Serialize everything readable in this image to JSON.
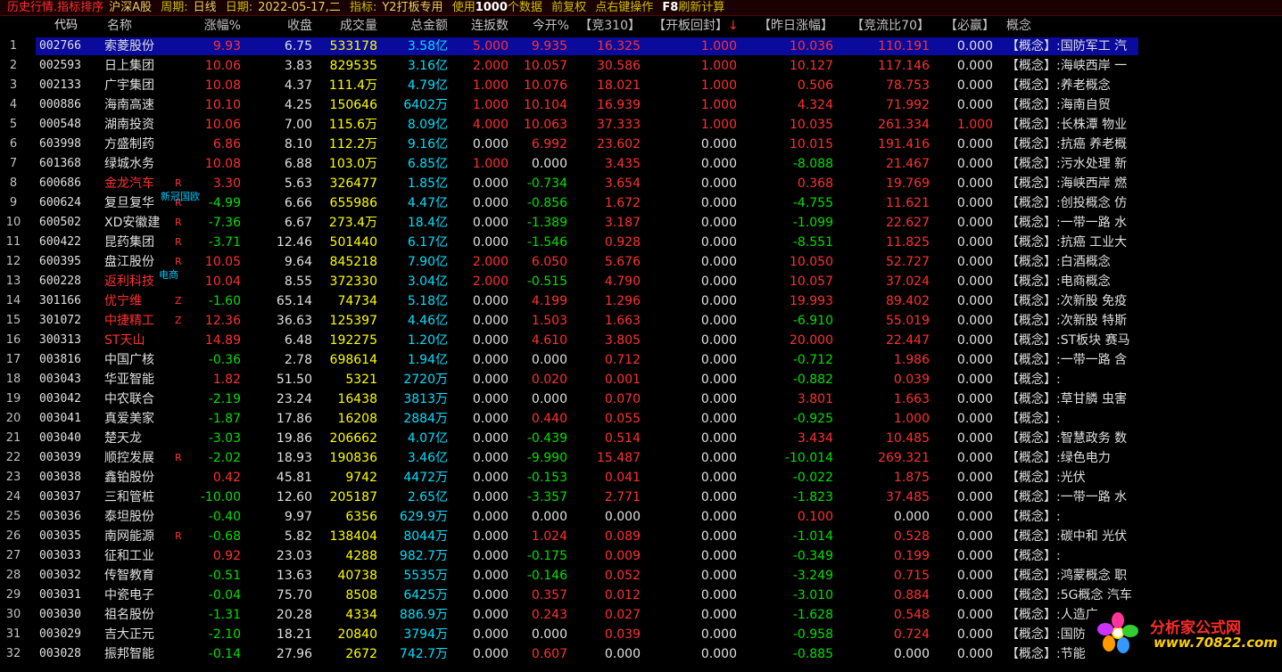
{
  "topbar": {
    "mode": "历史行情.指标排序",
    "market": "沪深A股",
    "period_label": "周期:",
    "period": "日线",
    "date_label": "日期:",
    "date": "2022-05-17,二",
    "indicator_label": "指标:",
    "indicator": "Y2打板专用",
    "use_label": "使用",
    "count": "1000",
    "count_suffix": "个数据",
    "adjust": "前复权",
    "hint": "点右键操作",
    "f8": "F8",
    "f8_text": "刷新计算"
  },
  "columns": {
    "code": "代码",
    "name": "名称",
    "pct": "涨幅%",
    "close": "收盘",
    "volume": "成交量",
    "amount": "总金额",
    "lianban": "连扳数",
    "open": "今开%",
    "jing310": "【竞310】",
    "kbhf": "【开板回封】",
    "sort_arrow": "↓",
    "zrzf": "【昨日涨幅】",
    "jlb": "【竞流比70】",
    "biying": "【必赢】",
    "gainian": "概念"
  },
  "colors": {
    "up": "#ff3030",
    "down": "#00e000",
    "flat": "#e0e0e0",
    "selection": "#0a0a9c"
  },
  "rows": [
    {
      "idx": "1",
      "code": "002766",
      "name": "索菱股份",
      "tag": "",
      "sub": "",
      "pct": "9.93",
      "close": "6.75",
      "volume": "533178",
      "amount": "3.58",
      "amount_unit": "亿",
      "lb": "5.000",
      "open": "9.935",
      "j310": "16.325",
      "kbhf": "1.000",
      "zrzf": "10.036",
      "jlb": "110.191",
      "bw": "0.000",
      "gn": "【概念】:国防军工 汽"
    },
    {
      "idx": "2",
      "code": "002593",
      "name": "日上集团",
      "tag": "",
      "sub": "",
      "pct": "10.06",
      "close": "3.83",
      "volume": "829535",
      "amount": "3.16",
      "amount_unit": "亿",
      "lb": "2.000",
      "open": "10.057",
      "j310": "30.586",
      "kbhf": "1.000",
      "zrzf": "10.127",
      "jlb": "117.146",
      "bw": "0.000",
      "gn": "【概念】:海峡西岸 一"
    },
    {
      "idx": "3",
      "code": "002133",
      "name": "广宇集团",
      "tag": "",
      "sub": "",
      "pct": "10.08",
      "close": "4.37",
      "volume": "111.4万",
      "amount": "4.79",
      "amount_unit": "亿",
      "lb": "1.000",
      "open": "10.076",
      "j310": "18.021",
      "kbhf": "1.000",
      "zrzf": "0.506",
      "jlb": "78.753",
      "bw": "0.000",
      "gn": "【概念】:养老概念"
    },
    {
      "idx": "4",
      "code": "000886",
      "name": "海南高速",
      "tag": "",
      "sub": "",
      "pct": "10.10",
      "close": "4.25",
      "volume": "150646",
      "amount": "6402",
      "amount_unit": "万",
      "lb": "1.000",
      "open": "10.104",
      "j310": "16.939",
      "kbhf": "1.000",
      "zrzf": "4.324",
      "jlb": "71.992",
      "bw": "0.000",
      "gn": "【概念】:海南自贸"
    },
    {
      "idx": "5",
      "code": "000548",
      "name": "湖南投资",
      "tag": "",
      "sub": "",
      "pct": "10.06",
      "close": "7.00",
      "volume": "115.6万",
      "amount": "8.09",
      "amount_unit": "亿",
      "lb": "4.000",
      "open": "10.063",
      "j310": "37.333",
      "kbhf": "1.000",
      "zrzf": "10.035",
      "jlb": "261.334",
      "bw": "1.000",
      "gn": "【概念】:长株潭 物业"
    },
    {
      "idx": "6",
      "code": "603998",
      "name": "方盛制药",
      "tag": "",
      "sub": "",
      "pct": "6.86",
      "close": "8.10",
      "volume": "112.2万",
      "amount": "9.16",
      "amount_unit": "亿",
      "lb": "0.000",
      "open": "6.992",
      "j310": "23.602",
      "kbhf": "0.000",
      "zrzf": "10.015",
      "jlb": "191.416",
      "bw": "0.000",
      "gn": "【概念】:抗癌 养老概"
    },
    {
      "idx": "7",
      "code": "601368",
      "name": "绿城水务",
      "tag": "",
      "sub": "",
      "pct": "10.08",
      "close": "6.88",
      "volume": "103.0万",
      "amount": "6.85",
      "amount_unit": "亿",
      "lb": "1.000",
      "open": "0.000",
      "j310": "3.435",
      "kbhf": "0.000",
      "zrzf": "-8.088",
      "jlb": "21.467",
      "bw": "0.000",
      "gn": "【概念】:污水处理 新"
    },
    {
      "idx": "8",
      "code": "600686",
      "name": "金龙汽车",
      "tag": "R",
      "sub": "",
      "pct": "3.30",
      "close": "5.63",
      "volume": "326477",
      "amount": "1.85",
      "amount_unit": "亿",
      "lb": "0.000",
      "open": "-0.734",
      "j310": "3.654",
      "kbhf": "0.000",
      "zrzf": "0.368",
      "jlb": "19.769",
      "bw": "0.000",
      "gn": "【概念】:海峡西岸 燃"
    },
    {
      "idx": "9",
      "code": "600624",
      "name": "复旦复华",
      "tag": "R",
      "sub": "新冠国欧",
      "pct": "-4.99",
      "close": "6.66",
      "volume": "655986",
      "amount": "4.47",
      "amount_unit": "亿",
      "lb": "0.000",
      "open": "-0.856",
      "j310": "1.672",
      "kbhf": "0.000",
      "zrzf": "-4.755",
      "jlb": "11.621",
      "bw": "0.000",
      "gn": "【概念】:创投概念 仿"
    },
    {
      "idx": "10",
      "code": "600502",
      "name": "XD安徽建",
      "tag": "R",
      "sub": "",
      "pct": "-7.36",
      "close": "6.67",
      "volume": "273.4万",
      "amount": "18.4",
      "amount_unit": "亿",
      "lb": "0.000",
      "open": "-1.389",
      "j310": "3.187",
      "kbhf": "0.000",
      "zrzf": "-1.099",
      "jlb": "22.627",
      "bw": "0.000",
      "gn": "【概念】:一带一路 水"
    },
    {
      "idx": "11",
      "code": "600422",
      "name": "昆药集团",
      "tag": "R",
      "sub": "",
      "pct": "-3.71",
      "close": "12.46",
      "volume": "501440",
      "amount": "6.17",
      "amount_unit": "亿",
      "lb": "0.000",
      "open": "-1.546",
      "j310": "0.928",
      "kbhf": "0.000",
      "zrzf": "-8.551",
      "jlb": "11.825",
      "bw": "0.000",
      "gn": "【概念】:抗癌 工业大"
    },
    {
      "idx": "12",
      "code": "600395",
      "name": "盘江股份",
      "tag": "R",
      "sub": "",
      "pct": "10.05",
      "close": "9.64",
      "volume": "845218",
      "amount": "7.90",
      "amount_unit": "亿",
      "lb": "2.000",
      "open": "6.050",
      "j310": "5.676",
      "kbhf": "0.000",
      "zrzf": "10.050",
      "jlb": "52.727",
      "bw": "0.000",
      "gn": "【概念】:白酒概念"
    },
    {
      "idx": "13",
      "code": "600228",
      "name": "返利科技",
      "tag": "",
      "sub": "电商",
      "pct": "10.04",
      "close": "8.55",
      "volume": "372330",
      "amount": "3.04",
      "amount_unit": "亿",
      "lb": "2.000",
      "open": "-0.515",
      "j310": "4.790",
      "kbhf": "0.000",
      "zrzf": "10.057",
      "jlb": "37.024",
      "bw": "0.000",
      "gn": "【概念】:电商概念"
    },
    {
      "idx": "14",
      "code": "301166",
      "name": "优宁维",
      "tag": "Z",
      "sub": "",
      "pct": "-1.60",
      "close": "65.14",
      "volume": "74734",
      "amount": "5.18",
      "amount_unit": "亿",
      "lb": "0.000",
      "open": "4.199",
      "j310": "1.296",
      "kbhf": "0.000",
      "zrzf": "19.993",
      "jlb": "89.402",
      "bw": "0.000",
      "gn": "【概念】:次新股 免疫"
    },
    {
      "idx": "15",
      "code": "301072",
      "name": "中捷精工",
      "tag": "Z",
      "sub": "",
      "pct": "12.36",
      "close": "36.63",
      "volume": "125397",
      "amount": "4.46",
      "amount_unit": "亿",
      "lb": "0.000",
      "open": "1.503",
      "j310": "1.663",
      "kbhf": "0.000",
      "zrzf": "-6.910",
      "jlb": "55.019",
      "bw": "0.000",
      "gn": "【概念】:次新股 特斯"
    },
    {
      "idx": "16",
      "code": "300313",
      "name": "ST天山",
      "tag": "",
      "sub": "",
      "pct": "14.89",
      "close": "6.48",
      "volume": "192275",
      "amount": "1.20",
      "amount_unit": "亿",
      "lb": "0.000",
      "open": "4.610",
      "j310": "3.805",
      "kbhf": "0.000",
      "zrzf": "20.000",
      "jlb": "22.447",
      "bw": "0.000",
      "gn": "【概念】:ST板块 赛马"
    },
    {
      "idx": "17",
      "code": "003816",
      "name": "中国广核",
      "tag": "",
      "sub": "",
      "pct": "-0.36",
      "close": "2.78",
      "volume": "698614",
      "amount": "1.94",
      "amount_unit": "亿",
      "lb": "0.000",
      "open": "0.000",
      "j310": "0.712",
      "kbhf": "0.000",
      "zrzf": "-0.712",
      "jlb": "1.986",
      "bw": "0.000",
      "gn": "【概念】:一带一路 含"
    },
    {
      "idx": "18",
      "code": "003043",
      "name": "华亚智能",
      "tag": "",
      "sub": "",
      "pct": "1.82",
      "close": "51.50",
      "volume": "5321",
      "amount": "2720",
      "amount_unit": "万",
      "lb": "0.000",
      "open": "0.020",
      "j310": "0.001",
      "kbhf": "0.000",
      "zrzf": "-0.882",
      "jlb": "0.039",
      "bw": "0.000",
      "gn": "【概念】:"
    },
    {
      "idx": "19",
      "code": "003042",
      "name": "中农联合",
      "tag": "",
      "sub": "",
      "pct": "-2.19",
      "close": "23.24",
      "volume": "16438",
      "amount": "3813",
      "amount_unit": "万",
      "lb": "0.000",
      "open": "0.000",
      "j310": "0.070",
      "kbhf": "0.000",
      "zrzf": "3.801",
      "jlb": "1.663",
      "bw": "0.000",
      "gn": "【概念】:草甘膦 虫害"
    },
    {
      "idx": "20",
      "code": "003041",
      "name": "真爱美家",
      "tag": "",
      "sub": "",
      "pct": "-1.87",
      "close": "17.86",
      "volume": "16208",
      "amount": "2884",
      "amount_unit": "万",
      "lb": "0.000",
      "open": "0.440",
      "j310": "0.055",
      "kbhf": "0.000",
      "zrzf": "-0.925",
      "jlb": "1.000",
      "bw": "0.000",
      "gn": "【概念】:"
    },
    {
      "idx": "21",
      "code": "003040",
      "name": "楚天龙",
      "tag": "",
      "sub": "",
      "pct": "-3.03",
      "close": "19.86",
      "volume": "206662",
      "amount": "4.07",
      "amount_unit": "亿",
      "lb": "0.000",
      "open": "-0.439",
      "j310": "0.514",
      "kbhf": "0.000",
      "zrzf": "3.434",
      "jlb": "10.485",
      "bw": "0.000",
      "gn": "【概念】:智慧政务 数"
    },
    {
      "idx": "22",
      "code": "003039",
      "name": "顺控发展",
      "tag": "R",
      "sub": "",
      "pct": "-2.02",
      "close": "18.93",
      "volume": "190836",
      "amount": "3.46",
      "amount_unit": "亿",
      "lb": "0.000",
      "open": "-9.990",
      "j310": "15.487",
      "kbhf": "0.000",
      "zrzf": "-10.014",
      "jlb": "269.321",
      "bw": "0.000",
      "gn": "【概念】:绿色电力"
    },
    {
      "idx": "23",
      "code": "003038",
      "name": "鑫铂股份",
      "tag": "",
      "sub": "",
      "pct": "0.42",
      "close": "45.81",
      "volume": "9742",
      "amount": "4472",
      "amount_unit": "万",
      "lb": "0.000",
      "open": "-0.153",
      "j310": "0.041",
      "kbhf": "0.000",
      "zrzf": "-0.022",
      "jlb": "1.875",
      "bw": "0.000",
      "gn": "【概念】:光伏"
    },
    {
      "idx": "24",
      "code": "003037",
      "name": "三和管桩",
      "tag": "",
      "sub": "",
      "pct": "-10.00",
      "close": "12.60",
      "volume": "205187",
      "amount": "2.65",
      "amount_unit": "亿",
      "lb": "0.000",
      "open": "-3.357",
      "j310": "2.771",
      "kbhf": "0.000",
      "zrzf": "-1.823",
      "jlb": "37.485",
      "bw": "0.000",
      "gn": "【概念】:一带一路 水"
    },
    {
      "idx": "25",
      "code": "003036",
      "name": "泰坦股份",
      "tag": "",
      "sub": "",
      "pct": "-0.40",
      "close": "9.97",
      "volume": "6356",
      "amount": "629.9",
      "amount_unit": "万",
      "lb": "0.000",
      "open": "0.000",
      "j310": "0.000",
      "kbhf": "0.000",
      "zrzf": "0.100",
      "jlb": "0.000",
      "bw": "0.000",
      "gn": "【概念】:"
    },
    {
      "idx": "26",
      "code": "003035",
      "name": "南网能源",
      "tag": "R",
      "sub": "",
      "pct": "-0.68",
      "close": "5.82",
      "volume": "138404",
      "amount": "8044",
      "amount_unit": "万",
      "lb": "0.000",
      "open": "1.024",
      "j310": "0.089",
      "kbhf": "0.000",
      "zrzf": "-1.014",
      "jlb": "0.528",
      "bw": "0.000",
      "gn": "【概念】:碳中和 光伏"
    },
    {
      "idx": "27",
      "code": "003033",
      "name": "征和工业",
      "tag": "",
      "sub": "",
      "pct": "0.92",
      "close": "23.03",
      "volume": "4288",
      "amount": "982.7",
      "amount_unit": "万",
      "lb": "0.000",
      "open": "-0.175",
      "j310": "0.009",
      "kbhf": "0.000",
      "zrzf": "-0.349",
      "jlb": "0.199",
      "bw": "0.000",
      "gn": "【概念】:"
    },
    {
      "idx": "28",
      "code": "003032",
      "name": "传智教育",
      "tag": "",
      "sub": "",
      "pct": "-0.51",
      "close": "13.63",
      "volume": "40738",
      "amount": "5535",
      "amount_unit": "万",
      "lb": "0.000",
      "open": "-0.146",
      "j310": "0.052",
      "kbhf": "0.000",
      "zrzf": "-3.249",
      "jlb": "0.715",
      "bw": "0.000",
      "gn": "【概念】:鸿蒙概念 职"
    },
    {
      "idx": "29",
      "code": "003031",
      "name": "中瓷电子",
      "tag": "",
      "sub": "",
      "pct": "-0.04",
      "close": "75.70",
      "volume": "8508",
      "amount": "6425",
      "amount_unit": "万",
      "lb": "0.000",
      "open": "0.357",
      "j310": "0.012",
      "kbhf": "0.000",
      "zrzf": "-3.010",
      "jlb": "0.884",
      "bw": "0.000",
      "gn": "【概念】:5G概念 汽车"
    },
    {
      "idx": "30",
      "code": "003030",
      "name": "祖名股份",
      "tag": "",
      "sub": "",
      "pct": "-1.31",
      "close": "20.28",
      "volume": "4334",
      "amount": "886.9",
      "amount_unit": "万",
      "lb": "0.000",
      "open": "0.243",
      "j310": "0.027",
      "kbhf": "0.000",
      "zrzf": "-1.628",
      "jlb": "0.548",
      "bw": "0.000",
      "gn": "【概念】:人造广"
    },
    {
      "idx": "31",
      "code": "003029",
      "name": "吉大正元",
      "tag": "",
      "sub": "",
      "pct": "-2.10",
      "close": "18.21",
      "volume": "20840",
      "amount": "3794",
      "amount_unit": "万",
      "lb": "0.000",
      "open": "0.000",
      "j310": "0.039",
      "kbhf": "0.000",
      "zrzf": "-0.958",
      "jlb": "0.724",
      "bw": "0.000",
      "gn": "【概念】:国防"
    },
    {
      "idx": "32",
      "code": "003028",
      "name": "振邦智能",
      "tag": "",
      "sub": "",
      "pct": "-0.14",
      "close": "27.96",
      "volume": "2672",
      "amount": "742.7",
      "amount_unit": "万",
      "lb": "0.000",
      "open": "0.607",
      "j310": "0.000",
      "kbhf": "0.000",
      "zrzf": "-0.885",
      "jlb": "0.000",
      "bw": "0.000",
      "gn": "【概念】:节能"
    }
  ],
  "watermark": {
    "text": "分析家公式网",
    "url": "www.70822.com"
  }
}
